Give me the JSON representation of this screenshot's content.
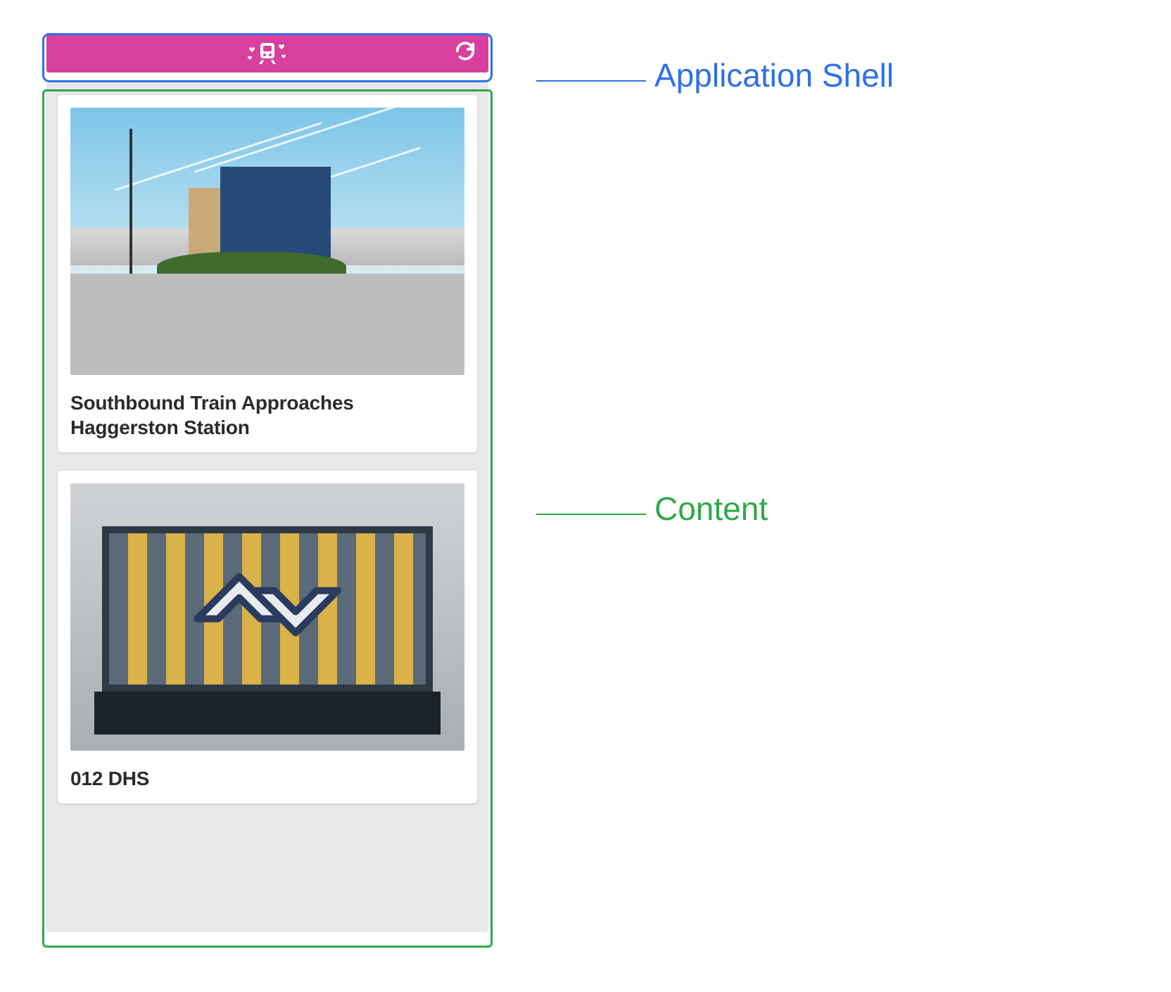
{
  "annotations": {
    "shell_label": "Application Shell",
    "content_label": "Content",
    "shell_color": "#2f6fed",
    "content_color": "#2fa84a"
  },
  "appbar": {
    "brand_color": "#d83f9e",
    "logo_icon": "train-hearts-icon",
    "refresh_icon": "refresh-icon"
  },
  "cards": [
    {
      "title": "Southbound Train Approaches Haggerston Station"
    },
    {
      "title": "012 DHS"
    }
  ]
}
